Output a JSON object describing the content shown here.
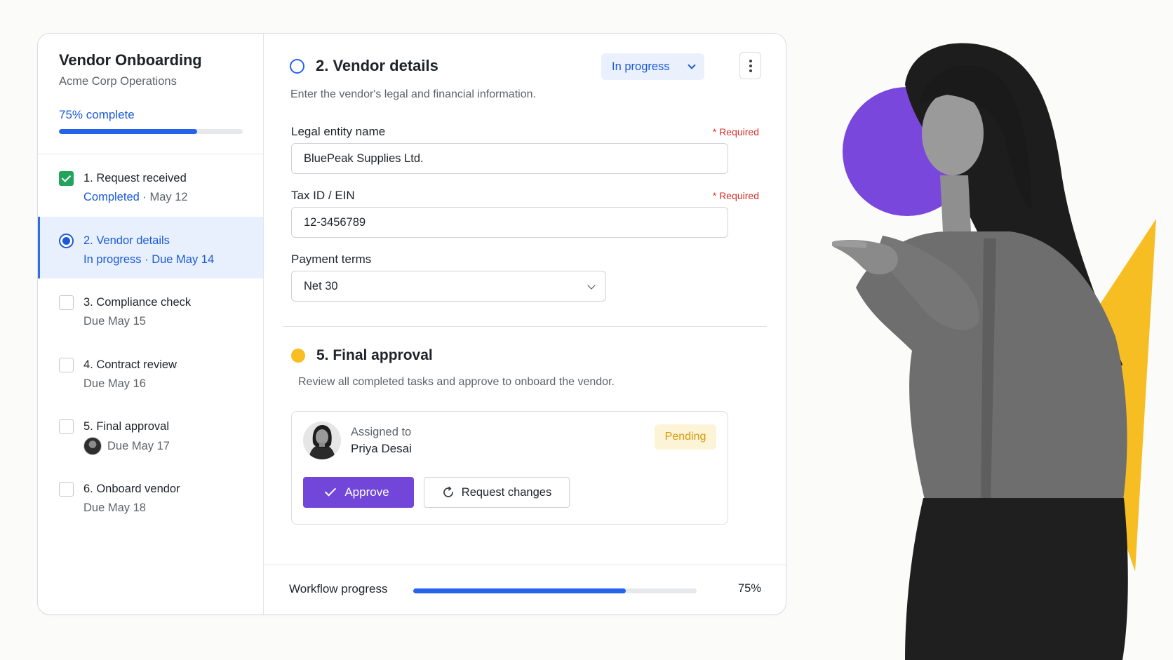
{
  "sidebar": {
    "title": "Vendor Onboarding",
    "subtitle": "Acme Corp Operations",
    "progress_label": "75% complete",
    "progress_value": 0.75,
    "steps": [
      {
        "name": "1. Request received",
        "status": "Completed",
        "sep": " · ",
        "date": "May 12",
        "state": "done"
      },
      {
        "name": "2. Vendor details",
        "meta": "In progress · Due May 14",
        "state": "active"
      },
      {
        "name": "3. Compliance check",
        "meta": "Due May 15",
        "state": "todo"
      },
      {
        "name": "4. Contract review",
        "meta": "Due May 16",
        "state": "todo"
      },
      {
        "name": "5. Final approval",
        "meta": "Due May 17",
        "state": "todo",
        "has_avatar": true
      },
      {
        "name": "6. Onboard vendor",
        "meta": "Due May 18",
        "state": "todo"
      }
    ]
  },
  "vendor_details": {
    "title": "2. Vendor details",
    "status": "In progress",
    "description": "Enter the vendor's legal and financial information.",
    "fields": {
      "legal_name": {
        "label": "Legal entity name",
        "required": "* Required",
        "value": "BluePeak Supplies Ltd."
      },
      "tax_id": {
        "label": "Tax ID / EIN",
        "required": "* Required",
        "value": "12-3456789"
      },
      "payment_terms": {
        "label": "Payment terms",
        "value": "Net 30"
      }
    }
  },
  "final_approval": {
    "title": "5. Final approval",
    "description": "Review all completed tasks and approve to onboard the vendor.",
    "assigned_label": "Assigned to",
    "assignee": "Priya Desai",
    "badge": "Pending",
    "approve_label": "Approve",
    "request_changes_label": "Request changes"
  },
  "footer": {
    "label": "Workflow progress",
    "percent": "75%",
    "progress_value": 0.75
  },
  "colors": {
    "accent_blue": "#2563eb",
    "approve_purple": "#7146d8",
    "success_green": "#22a45d",
    "pending_yellow": "#f7be24",
    "deco_purple": "#7a47dd",
    "deco_yellow": "#f7be24"
  },
  "icons": {
    "status_chevron": "chevron-down-icon",
    "menu": "more-vertical-icon",
    "approve": "check-icon",
    "request_changes": "refresh-icon"
  }
}
